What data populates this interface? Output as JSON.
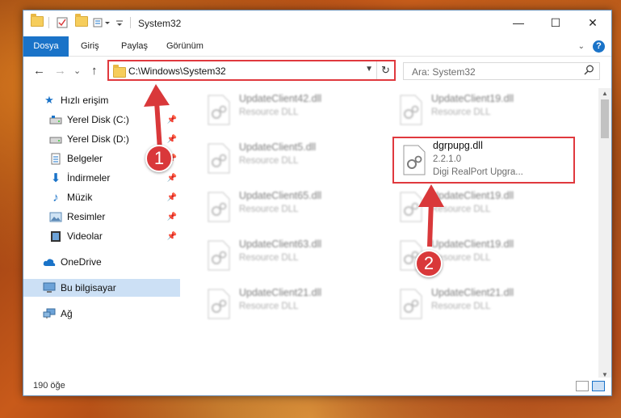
{
  "window": {
    "title": "System32",
    "minimize": "—",
    "maximize": "☐",
    "close": "✕"
  },
  "ribbon": {
    "tabs": [
      "Dosya",
      "Giriş",
      "Paylaş",
      "Görünüm"
    ],
    "help": "?"
  },
  "nav": {
    "back": "←",
    "forward": "→",
    "recent": "⌄",
    "up": "↑",
    "address": "C:\\Windows\\System32",
    "refresh": "↻",
    "search_placeholder": "Ara: System32"
  },
  "sidebar": {
    "items": [
      {
        "label": "Hızlı erişim",
        "icon": "star-icon"
      },
      {
        "label": "Yerel Disk (C:)",
        "icon": "drive-icon"
      },
      {
        "label": "Yerel Disk (D:)",
        "icon": "drive-icon"
      },
      {
        "label": "Belgeler",
        "icon": "document-icon"
      },
      {
        "label": "İndirmeler",
        "icon": "download-icon"
      },
      {
        "label": "Müzik",
        "icon": "music-icon"
      },
      {
        "label": "Resimler",
        "icon": "pictures-icon"
      },
      {
        "label": "Videolar",
        "icon": "video-icon"
      },
      {
        "label": "OneDrive",
        "icon": "cloud-icon"
      },
      {
        "label": "Bu bilgisayar",
        "icon": "computer-icon"
      },
      {
        "label": "Ağ",
        "icon": "network-icon"
      }
    ]
  },
  "files": {
    "left": [
      {
        "name": "UpdateClient42.dll",
        "desc": "Resource DLL"
      },
      {
        "name": "UpdateClient5.dll",
        "desc": "Resource DLL"
      },
      {
        "name": "UpdateClient65.dll",
        "desc": "Resource DLL"
      },
      {
        "name": "UpdateClient63.dll",
        "desc": "Resource DLL"
      },
      {
        "name": "UpdateClient21.dll",
        "desc": "Resource DLL"
      }
    ],
    "right": [
      {
        "name": "UpdateClient19.dll",
        "desc": "Resource DLL"
      },
      {
        "name": "UpdateClient19.dll",
        "desc": "Resource DLL"
      },
      {
        "name": "UpdateClient19.dll",
        "desc": "Resource DLL"
      },
      {
        "name": "UpdateClient21.dll",
        "desc": "Resource DLL"
      }
    ],
    "highlighted": {
      "name": "dgrpupg.dll",
      "version": "2.2.1.0",
      "desc": "Digi RealPort Upgra..."
    }
  },
  "status": {
    "count": "190 öğe"
  },
  "annotations": {
    "badge1": "1",
    "badge2": "2",
    "color": "#d9383a"
  }
}
